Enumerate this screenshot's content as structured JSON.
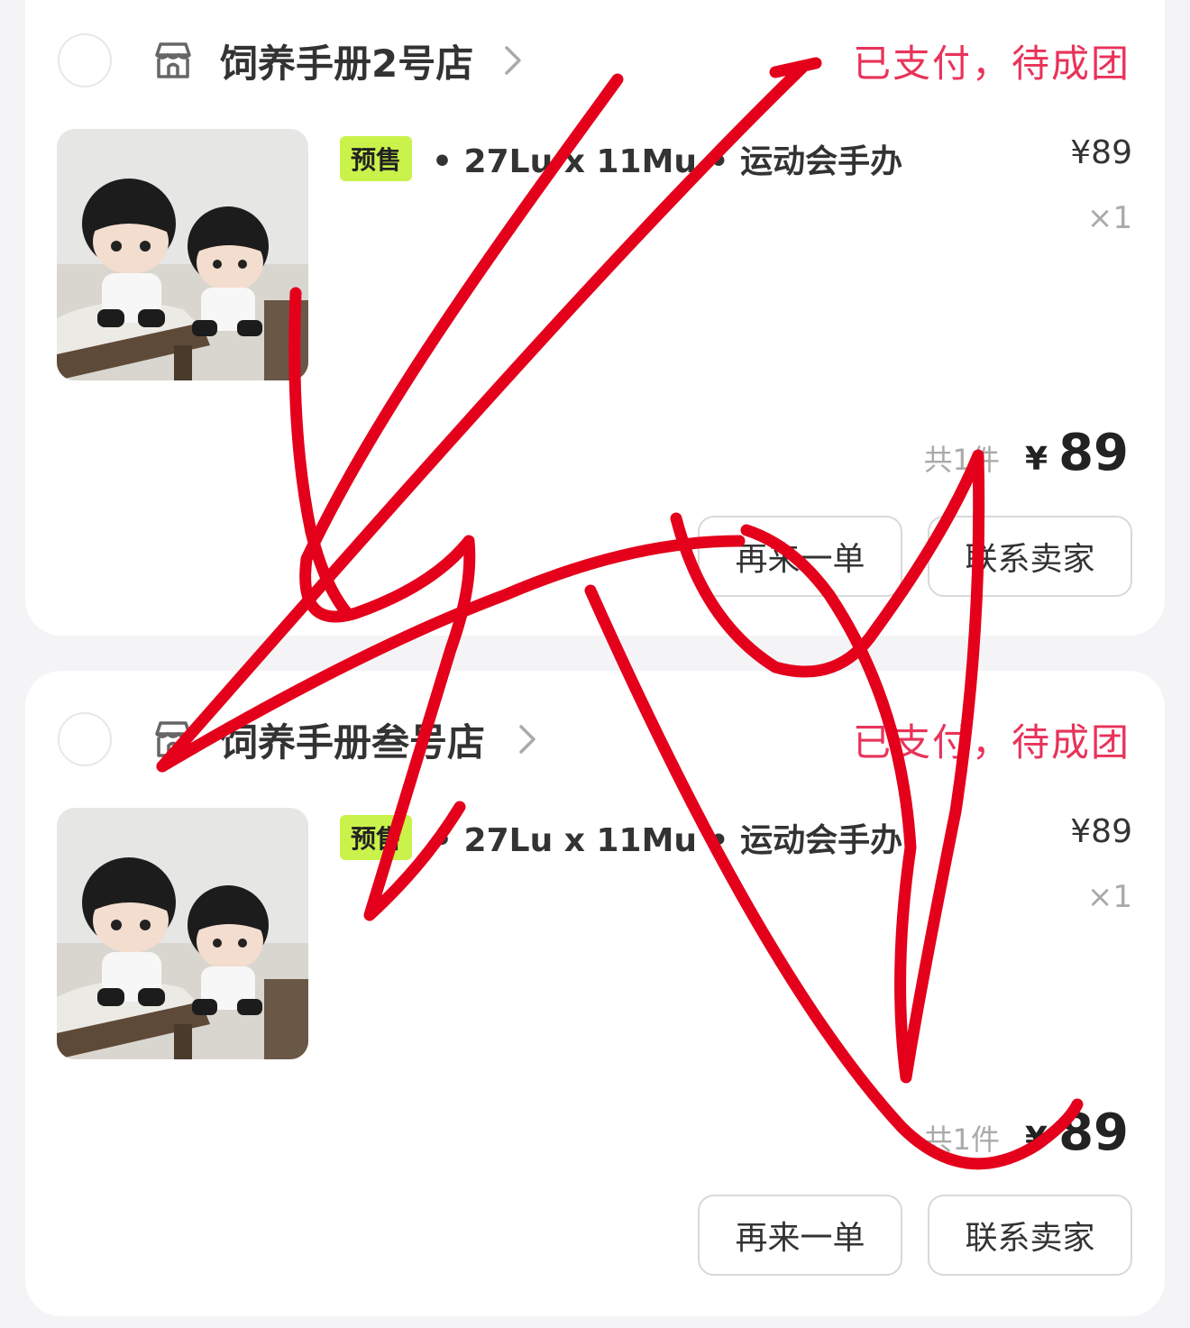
{
  "orders": [
    {
      "shop_name": "饲养手册2号店",
      "status": "已支付，待成团",
      "presale_tag": "预售",
      "product_title": "• 27Lu x 11Mu • 运动会手办",
      "unit_price": "¥89",
      "quantity": "×1",
      "total_count": "共1件",
      "total_currency": "¥",
      "total_amount": "89",
      "buttons": {
        "reorder": "再来一单",
        "contact_seller": "联系卖家"
      }
    },
    {
      "shop_name": "饲养手册叁号店",
      "status": "已支付，待成团",
      "presale_tag": "预售",
      "product_title": "• 27Lu x 11Mu • 运动会手办",
      "unit_price": "¥89",
      "quantity": "×1",
      "total_count": "共1件",
      "total_currency": "¥",
      "total_amount": "89",
      "buttons": {
        "reorder": "再来一单",
        "contact_seller": "联系卖家"
      }
    }
  ],
  "icons": {
    "shop": "shop-icon",
    "chevron": "chevron-right-icon",
    "select": "select-circle-icon"
  },
  "colors": {
    "status_red": "#e8335a",
    "presale_tag_bg": "#c9f24a",
    "scribble_red": "#e4001b"
  }
}
